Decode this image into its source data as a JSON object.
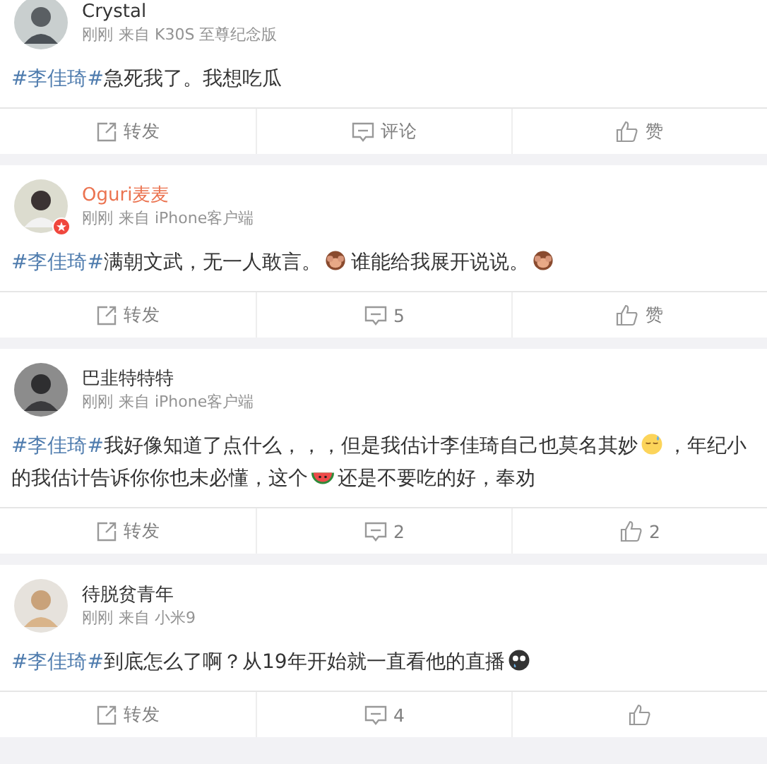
{
  "posts": [
    {
      "author": "Crystal",
      "vip": false,
      "verified": false,
      "time": "刚刚",
      "source": "来自 K30S 至尊纪念版",
      "content": [
        {
          "kind": "hashtag",
          "text": "#李佳琦#"
        },
        {
          "kind": "text",
          "text": "急死我了。我想吃瓜"
        }
      ],
      "actions": [
        "转发",
        "评论",
        "赞"
      ]
    },
    {
      "author": "Oguri麦麦",
      "vip": true,
      "verified": true,
      "time": "刚刚",
      "source": "来自 iPhone客户端",
      "content": [
        {
          "kind": "hashtag",
          "text": "#李佳琦#"
        },
        {
          "kind": "text",
          "text": "满朝文武，无一人敢言。"
        },
        {
          "kind": "monkey"
        },
        {
          "kind": "text",
          "text": "谁能给我展开说说。"
        },
        {
          "kind": "monkey"
        }
      ],
      "actions": [
        "转发",
        "5",
        "赞"
      ]
    },
    {
      "author": "巴韭特特特",
      "vip": false,
      "verified": false,
      "time": "刚刚",
      "source": "来自 iPhone客户端",
      "content": [
        {
          "kind": "hashtag",
          "text": "#李佳琦#"
        },
        {
          "kind": "text",
          "text": "我好像知道了点什么，，，但是我估计李佳琦自己也莫名其妙"
        },
        {
          "kind": "sweat"
        },
        {
          "kind": "text",
          "text": "，年纪小的我估计告诉你你也未必懂，这个"
        },
        {
          "kind": "watermelon"
        },
        {
          "kind": "text",
          "text": "还是不要吃的好，奉劝"
        }
      ],
      "actions": [
        "转发",
        "2",
        "2"
      ]
    },
    {
      "author": "待脱贫青年",
      "vip": false,
      "verified": false,
      "time": "刚刚",
      "source": "来自 小米9",
      "content": [
        {
          "kind": "hashtag",
          "text": "#李佳琦#"
        },
        {
          "kind": "text",
          "text": "到底怎么了啊？从19年开始就一直看他的直播"
        },
        {
          "kind": "tearful"
        }
      ],
      "actions": [
        "转发",
        "4"
      ]
    }
  ]
}
